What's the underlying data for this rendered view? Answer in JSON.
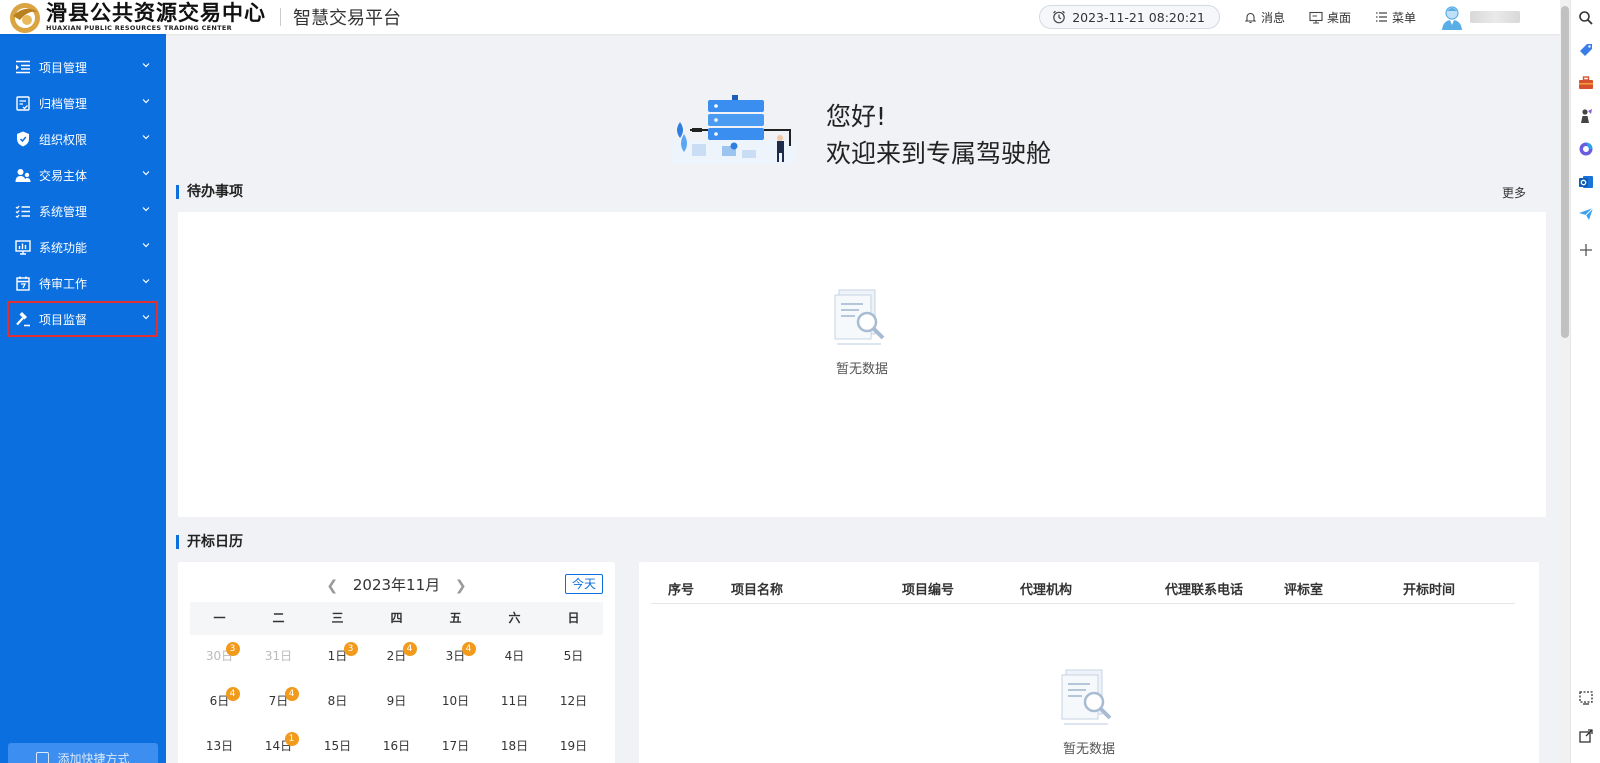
{
  "header": {
    "logo_cn": "滑县公共资源交易中心",
    "logo_en": "HUAXIAN PUBLIC RESOURCES TRADING CENTER",
    "platform_title": "智慧交易平台",
    "datetime": "2023-11-21 08:20:21",
    "links": {
      "messages": "消息",
      "desktop": "桌面",
      "menu": "菜单"
    }
  },
  "sidebar": {
    "items": [
      {
        "label": "项目管理",
        "icon": "list-indent-icon"
      },
      {
        "label": "归档管理",
        "icon": "archive-check-icon"
      },
      {
        "label": "组织权限",
        "icon": "shield-icon"
      },
      {
        "label": "交易主体",
        "icon": "users-icon"
      },
      {
        "label": "系统管理",
        "icon": "checklist-icon"
      },
      {
        "label": "系统功能",
        "icon": "monitor-icon"
      },
      {
        "label": "待审工作",
        "icon": "calendar-icon"
      },
      {
        "label": "项目监督",
        "icon": "hammer-icon"
      }
    ],
    "shortcut_label": "添加快捷方式"
  },
  "welcome": {
    "line1": "您好!",
    "line2": "欢迎来到专属驾驶舱"
  },
  "todo": {
    "title": "待办事项",
    "more": "更多",
    "empty_text": "暂无数据"
  },
  "calendar_section": {
    "title": "开标日历"
  },
  "calendar": {
    "month_label": "2023年11月",
    "today_label": "今天",
    "weekdays": [
      "一",
      "二",
      "三",
      "四",
      "五",
      "六",
      "日"
    ],
    "rows": [
      [
        {
          "d": "30日",
          "muted": true,
          "badge": "3"
        },
        {
          "d": "31日",
          "muted": true
        },
        {
          "d": "1日",
          "badge": "3"
        },
        {
          "d": "2日",
          "badge": "4"
        },
        {
          "d": "3日",
          "badge": "4"
        },
        {
          "d": "4日"
        },
        {
          "d": "5日"
        }
      ],
      [
        {
          "d": "6日",
          "badge": "4"
        },
        {
          "d": "7日",
          "badge": "4"
        },
        {
          "d": "8日"
        },
        {
          "d": "9日"
        },
        {
          "d": "10日"
        },
        {
          "d": "11日"
        },
        {
          "d": "12日"
        }
      ],
      [
        {
          "d": "13日"
        },
        {
          "d": "14日",
          "badge": "1"
        },
        {
          "d": "15日"
        },
        {
          "d": "16日"
        },
        {
          "d": "17日"
        },
        {
          "d": "18日"
        },
        {
          "d": "19日"
        }
      ]
    ]
  },
  "bid_table": {
    "columns": [
      "序号",
      "项目名称",
      "项目编号",
      "代理机构",
      "代理联系电话",
      "评标室",
      "开标时间"
    ],
    "empty_text": "暂无数据"
  },
  "colors": {
    "sidebar": "#0b6fe0",
    "badge": "#f29a1b",
    "highlight": "#e03030"
  }
}
